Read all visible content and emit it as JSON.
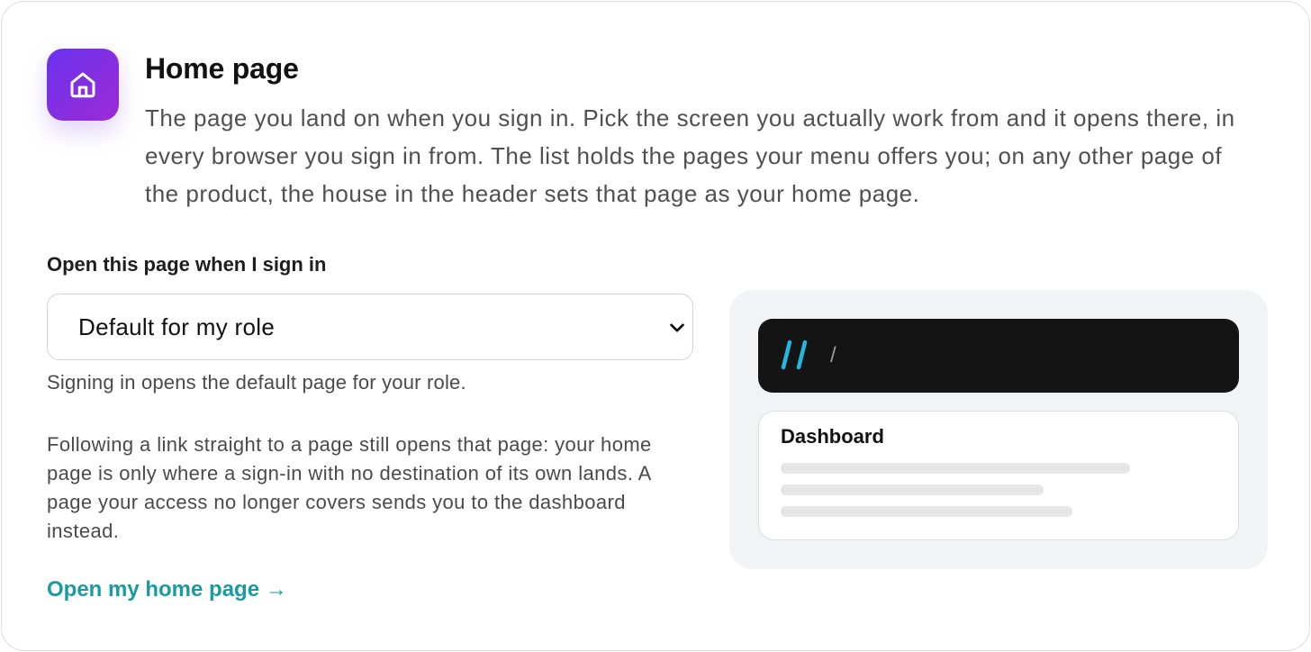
{
  "section": {
    "icon": "home-icon",
    "title": "Home page",
    "description": "The page you land on when you sign in. Pick the screen you actually work from and it opens there, in every browser you sign in from. The list holds the pages your menu offers you; on any other page of the product, the house in the header sets that page as your home page."
  },
  "form": {
    "label": "Open this page when I sign in",
    "selected_value": "Default for my role",
    "helper": "Signing in opens the default page for your role.",
    "note": "Following a link straight to a page still opens that page: your home page is only where a sign-in with no destination of its own lands. A page your access no longer covers sends you to the dashboard instead.",
    "link_label": "Open my home page →"
  },
  "preview": {
    "breadcrumb_separator": "/",
    "card_title": "Dashboard"
  },
  "colors": {
    "icon_gradient_start": "#6a33ee",
    "icon_gradient_end": "#9c2ad6",
    "link": "#1a9aa2",
    "logo_accent": "#22b8e0",
    "preview_header": "#141414",
    "preview_panel": "#f1f3f5"
  }
}
